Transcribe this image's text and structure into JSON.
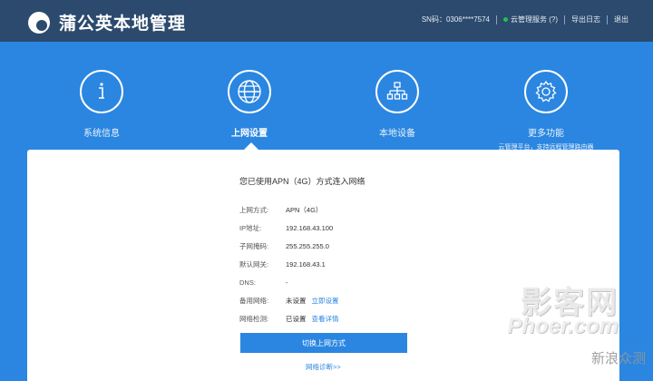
{
  "header": {
    "title": "蒲公英本地管理",
    "sn": "SN码：0306****7574",
    "cloud_service": "云管理服务 (?)",
    "export_log": "导出日志",
    "logout": "退出",
    "status_color": "#21c24b"
  },
  "nav": {
    "items": [
      {
        "label": "系统信息",
        "icon": "info-icon"
      },
      {
        "label": "上网设置",
        "icon": "globe-icon",
        "active": true
      },
      {
        "label": "本地设备",
        "icon": "network-tree-icon"
      },
      {
        "label": "更多功能",
        "icon": "gear-icon",
        "sub": "云管理平台，支持远程管理路由器"
      }
    ]
  },
  "panel": {
    "heading": "您已使用APN（4G）方式连入网络",
    "rows": [
      {
        "key": "上网方式:",
        "value": "APN（4G）"
      },
      {
        "key": "IP地址:",
        "value": "192.168.43.100"
      },
      {
        "key": "子网掩码:",
        "value": "255.255.255.0"
      },
      {
        "key": "默认网关:",
        "value": "192.168.43.1"
      },
      {
        "key": "DNS:",
        "value": "-"
      },
      {
        "key": "备用网络:",
        "value": "未设置",
        "link": "立即设置"
      },
      {
        "key": "网络检测:",
        "value": "已设置",
        "link": "查看详情"
      }
    ],
    "switch_button": "切换上网方式",
    "diagnose_link": "网络诊断>>"
  },
  "watermark": {
    "line1": "影客网",
    "line2": "Phoer.com",
    "line3": "新浪众测"
  },
  "colors": {
    "topbar": "#2b4a6e",
    "banner": "#2a86e0",
    "accent": "#2a86e0"
  }
}
